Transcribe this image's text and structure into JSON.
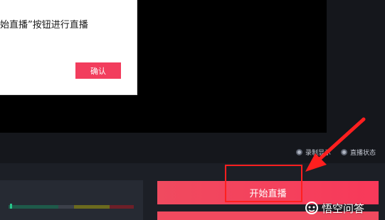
{
  "dialog": {
    "message": "始直播”按钮进行直播",
    "confirm_label": "确认"
  },
  "status": {
    "record_label": "录制显示",
    "live_label": "直播状态"
  },
  "main": {
    "start_live_label": "开始直播"
  },
  "watermark": {
    "text": "悟空问答",
    "logo": "wukong-logo"
  },
  "colors": {
    "accent": "#f23d5d",
    "highlight": "#ff1f1f",
    "meter_green": "#28c48a",
    "meter_yellow": "#6b6a1e",
    "meter_red": "#6e1f28"
  }
}
